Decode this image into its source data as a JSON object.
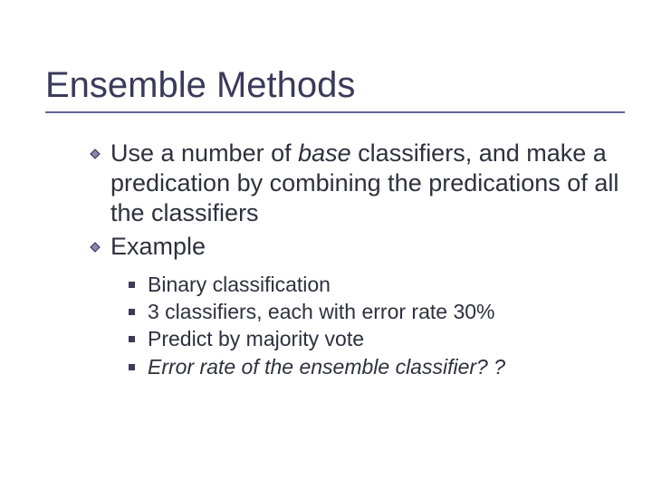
{
  "title": "Ensemble Methods",
  "bullets": {
    "b1_pre": "Use a number of ",
    "b1_it": "base",
    "b1_post": " classifiers, and make a predication by combining the predications of all the classifiers",
    "b2": "Example"
  },
  "sub": {
    "s1": "Binary classification",
    "s2": "3 classifiers, each with error rate 30%",
    "s3": "Predict by majority vote",
    "s4": "Error rate of the ensemble classifier? ?"
  }
}
